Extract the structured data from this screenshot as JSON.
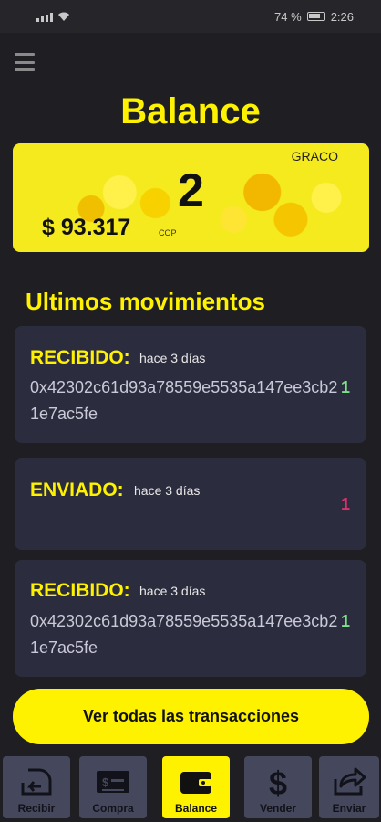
{
  "status_bar": {
    "battery": "74 %",
    "time": "2:26"
  },
  "menu": {
    "icon": "hamburger-menu-icon"
  },
  "page": {
    "title": "Balance"
  },
  "balance_card": {
    "token": "GRACO",
    "count": "2",
    "amount": "$ 93.317",
    "currency": "COP"
  },
  "movements": {
    "title": "Ultimos movimientos",
    "items": [
      {
        "type": "RECIBIDO:",
        "time": "hace 3 días",
        "hash": "0x42302c61d93a78559e5535a147ee3cb21e7ac5fe",
        "amount": "1",
        "amount_color": "#7ee08a"
      },
      {
        "type": "ENVIADO:",
        "time": "hace 3 días",
        "hash": "",
        "amount": "1",
        "amount_color": "#e0306a"
      },
      {
        "type": "RECIBIDO:",
        "time": "hace 3 días",
        "hash": "0x42302c61d93a78559e5535a147ee3cb21e7ac5fe",
        "amount": "1",
        "amount_color": "#7ee08a"
      }
    ]
  },
  "view_all_button": "Ver todas las transacciones",
  "nav": [
    {
      "label": "Recibir",
      "icon": "receive-icon"
    },
    {
      "label": "Compra",
      "icon": "buy-money-icon"
    },
    {
      "label": "Balance",
      "icon": "wallet-icon"
    },
    {
      "label": "Vender",
      "icon": "dollar-icon"
    },
    {
      "label": "Enviar",
      "icon": "send-share-icon"
    }
  ],
  "colors": {
    "accent": "#fff200",
    "background": "#1f1f23",
    "card_bg": "#2b2c3e",
    "received": "#7ee08a",
    "sent": "#e0306a"
  }
}
